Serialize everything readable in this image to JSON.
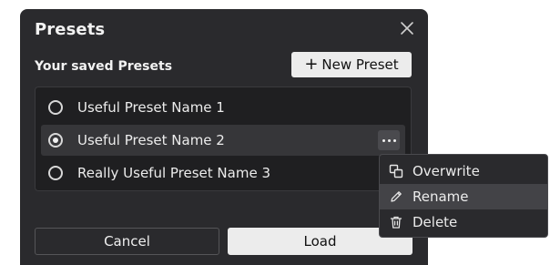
{
  "dialog": {
    "title": "Presets",
    "close_icon": "close-icon",
    "section_label": "Your saved Presets",
    "new_preset_label": "New Preset",
    "new_preset_icon": "plus-icon"
  },
  "presets": [
    {
      "label": "Useful Preset Name 1",
      "selected": false
    },
    {
      "label": "Useful Preset Name 2",
      "selected": true
    },
    {
      "label": "Really Useful Preset Name 3",
      "selected": false
    }
  ],
  "more_icon": "more-horizontal-icon",
  "context_menu": {
    "items": [
      {
        "label": "Overwrite",
        "icon": "overwrite-icon",
        "hovered": false
      },
      {
        "label": "Rename",
        "icon": "pencil-icon",
        "hovered": true
      },
      {
        "label": "Delete",
        "icon": "trash-icon",
        "hovered": false
      }
    ]
  },
  "footer": {
    "cancel_label": "Cancel",
    "load_label": "Load"
  },
  "colors": {
    "dialog_bg": "#2a2a2d",
    "list_bg": "#1f1f21",
    "selected_row_bg": "#363639",
    "primary_button_bg": "#ececec",
    "text": "#f2f2f2",
    "menu_hover_bg": "#434347"
  }
}
